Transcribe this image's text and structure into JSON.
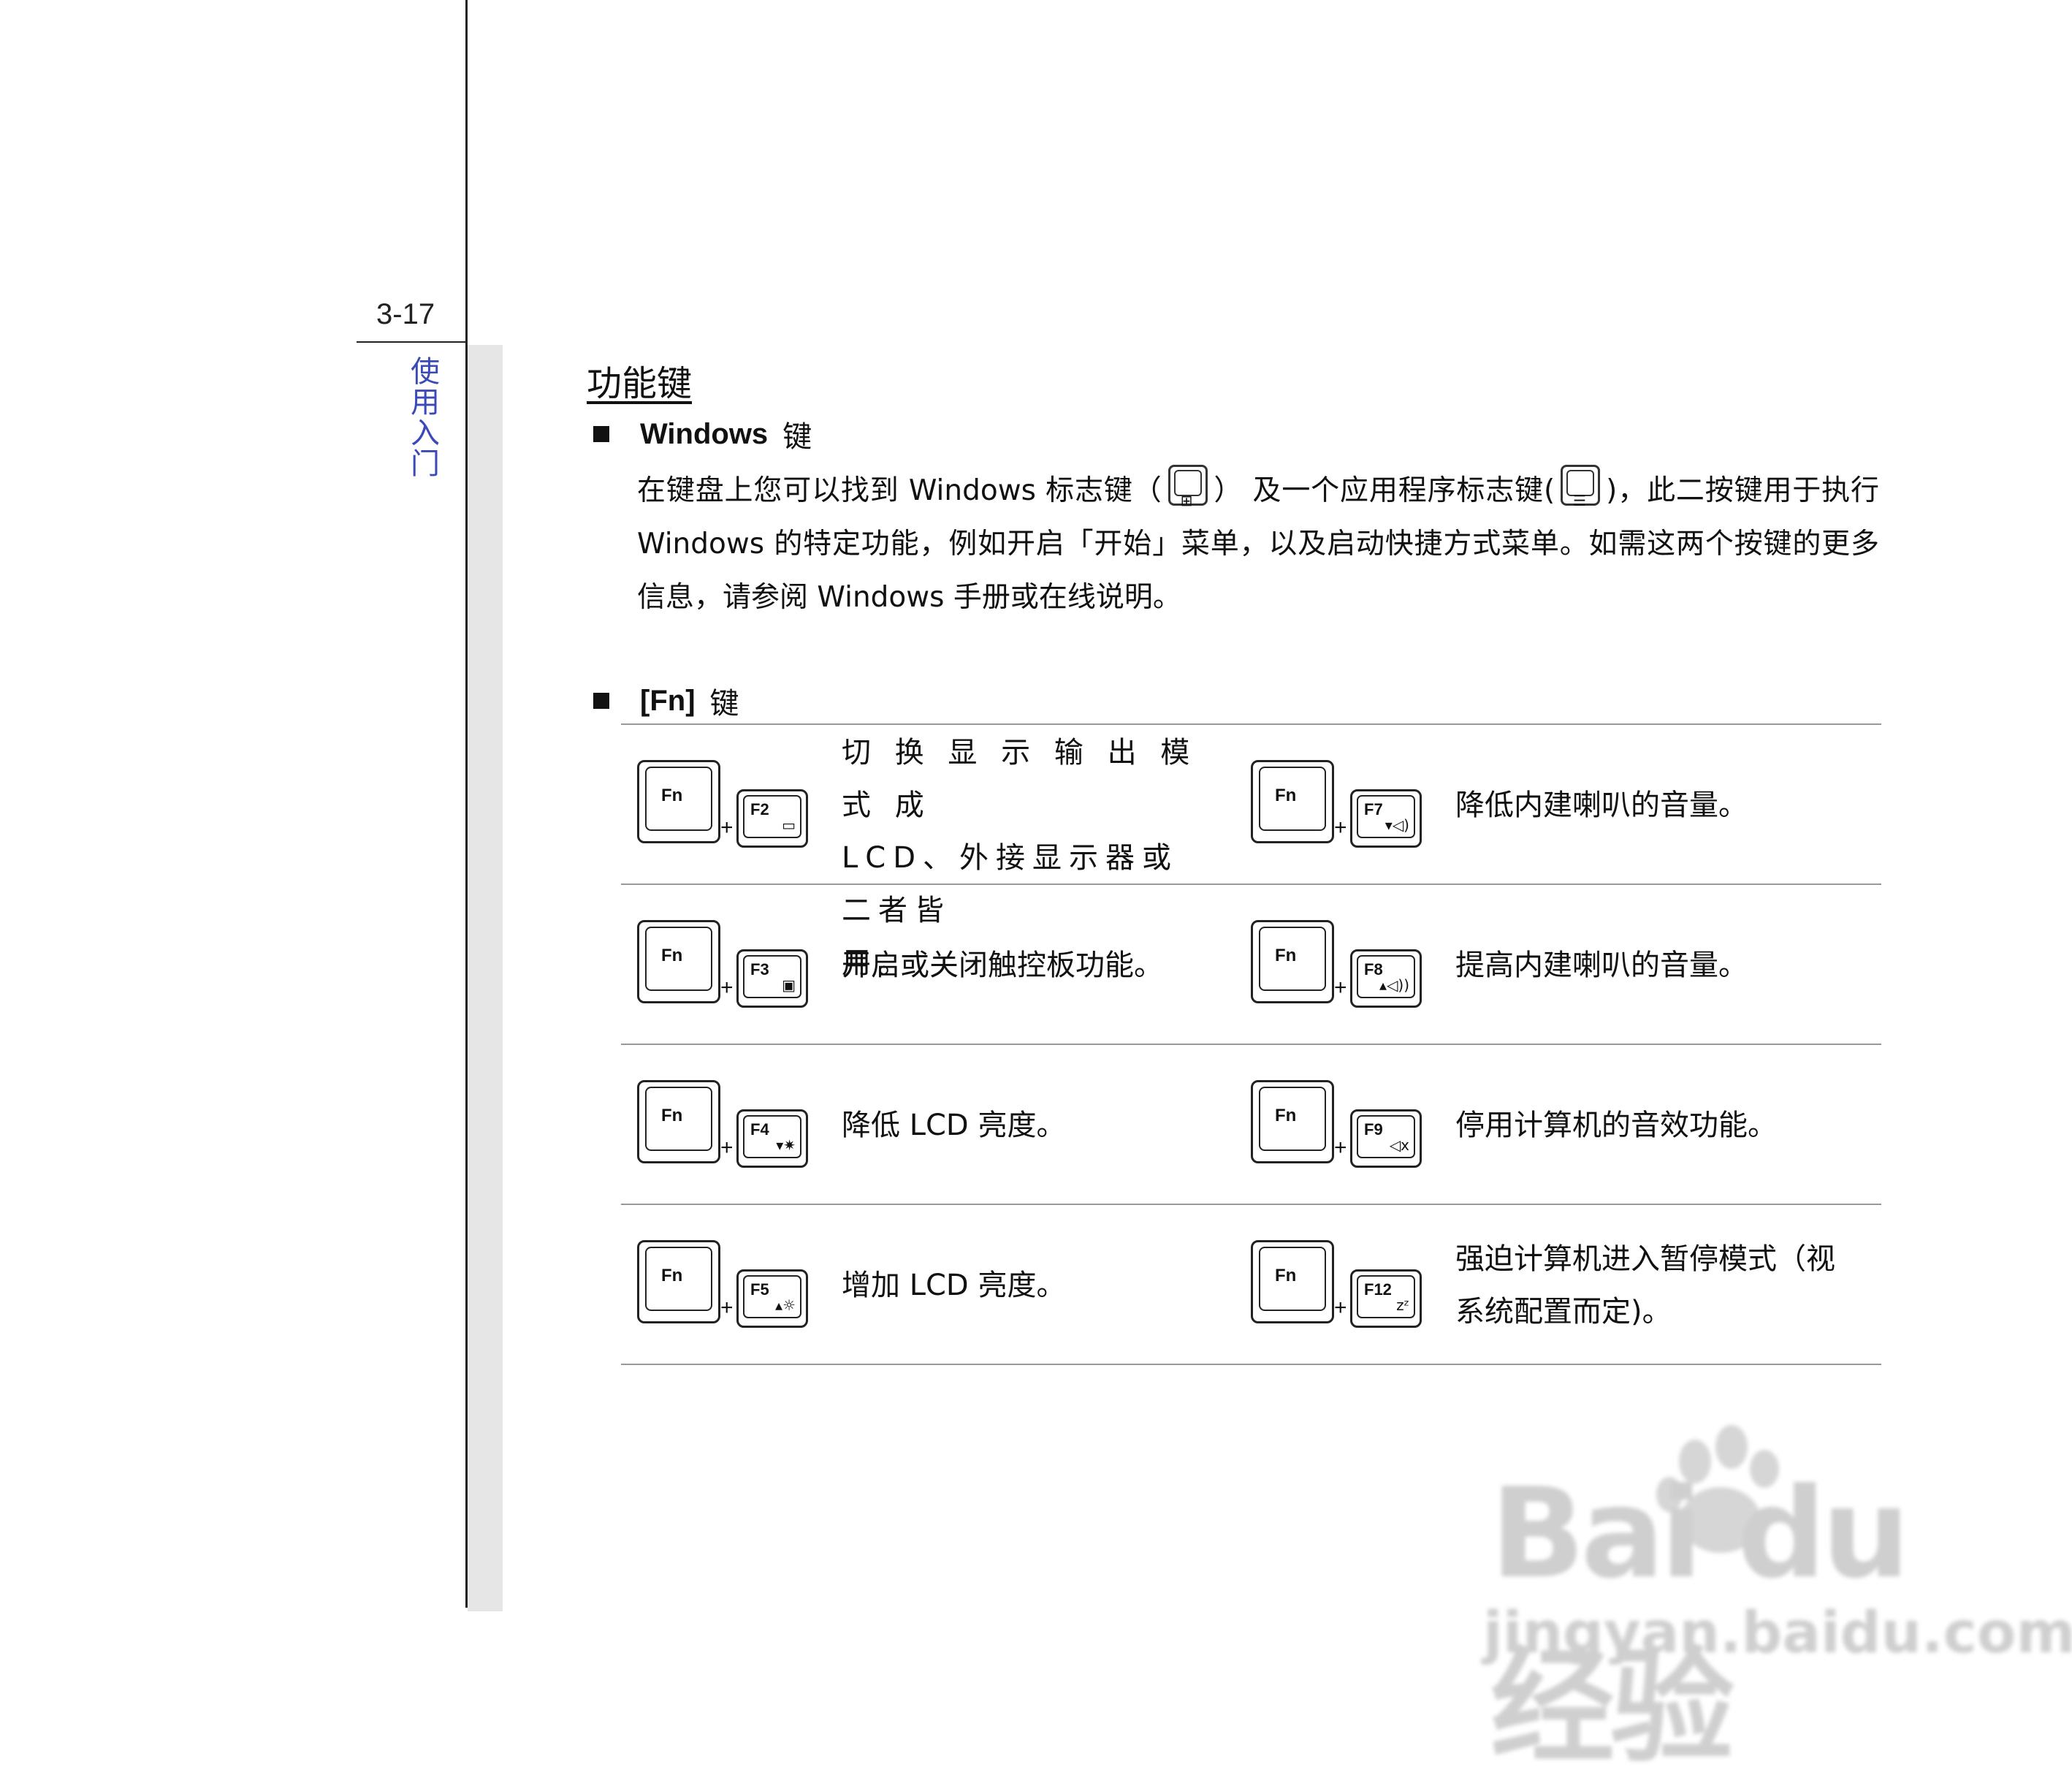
{
  "page_number": "3-17",
  "chapter_label": "使用入门",
  "section_title": "功能键",
  "windows_section": {
    "heading": "Windows",
    "heading_suffix": "键",
    "para_part1": "在键盘上您可以找到 Windows 标志键（",
    "para_part2": "） 及一个应用程序标志键(",
    "para_part3": ")，此二按键用于执行 Windows 的特定功能，例如开启「开始」菜单，以及启动快捷方式菜单。如需这两个按键的更多信息，请参阅 Windows 手册或在线说明。"
  },
  "fn_section": {
    "heading": "[Fn]",
    "heading_suffix": "键",
    "fn_key_label": "Fn",
    "plus": "+",
    "rows": [
      {
        "left": {
          "key": "F2",
          "symbol": "▭",
          "desc_lines": [
            "切 换 显 示 输 出 模 式 成",
            "LCD、外接显示器或二者皆",
            "用。"
          ]
        },
        "right": {
          "key": "F7",
          "symbol": "▾◁)",
          "desc_lines": [
            "降低内建喇叭的音量。"
          ]
        }
      },
      {
        "left": {
          "key": "F3",
          "symbol": "▣",
          "desc_lines": [
            "开启或关闭触控板功能。"
          ]
        },
        "right": {
          "key": "F8",
          "symbol": "▴◁))",
          "desc_lines": [
            "提高内建喇叭的音量。"
          ]
        }
      },
      {
        "left": {
          "key": "F4",
          "symbol": "▾✷",
          "desc_lines": [
            "降低 LCD 亮度。"
          ]
        },
        "right": {
          "key": "F9",
          "symbol": "◁x",
          "desc_lines": [
            "停用计算机的音效功能。"
          ]
        }
      },
      {
        "left": {
          "key": "F5",
          "symbol": "▴☼",
          "desc_lines": [
            "增加 LCD 亮度。"
          ]
        },
        "right": {
          "key": "F12",
          "symbol": "zᶻ",
          "desc_lines": [
            "强迫计算机进入暂停模式（视",
            "系统配置而定)。"
          ]
        }
      }
    ]
  },
  "watermark": {
    "brand": "Bai du 经验",
    "url": "jingyan.baidu.com"
  }
}
